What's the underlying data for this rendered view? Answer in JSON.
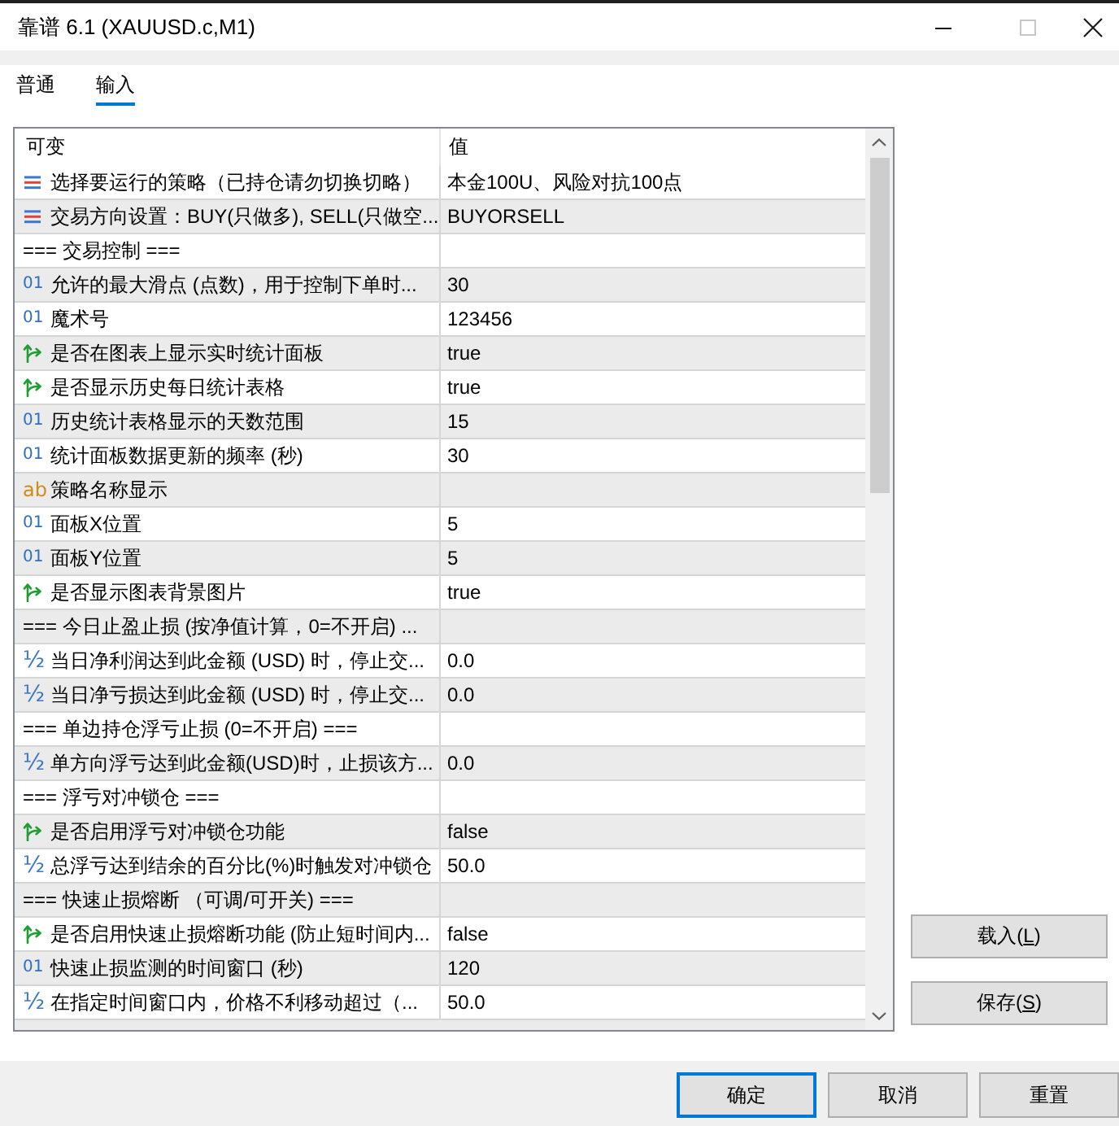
{
  "window": {
    "title": "靠谱 6.1 (XAUUSD.c,M1)",
    "controls": [
      {
        "kind": "minimize",
        "disabled": false
      },
      {
        "kind": "maximize",
        "disabled": true
      },
      {
        "kind": "close",
        "disabled": false
      }
    ]
  },
  "tabs": [
    {
      "label": "普通",
      "selected": false
    },
    {
      "label": "输入",
      "selected": true
    }
  ],
  "table": {
    "columns": [
      "可变",
      "值"
    ],
    "rows": [
      {
        "kind": "enum",
        "name": "选择要运行的策略（已持仓请勿切换切略）",
        "value": "本金100U、风险对抗100点"
      },
      {
        "kind": "enum",
        "name": "交易方向设置：BUY(只做多), SELL(只做空...",
        "value": "BUYORSELL"
      },
      {
        "kind": "section",
        "name": "=== 交易控制 ==="
      },
      {
        "kind": "int",
        "glyph": "01",
        "name": "允许的最大滑点 (点数)，用于控制下单时...",
        "value": "30"
      },
      {
        "kind": "int",
        "glyph": "01",
        "name": "魔术号",
        "value": "123456"
      },
      {
        "kind": "bool",
        "name": "是否在图表上显示实时统计面板",
        "value": "true"
      },
      {
        "kind": "bool",
        "name": "是否显示历史每日统计表格",
        "value": "true"
      },
      {
        "kind": "int",
        "glyph": "01",
        "name": "历史统计表格显示的天数范围",
        "value": "15"
      },
      {
        "kind": "int",
        "glyph": "01",
        "name": "统计面板数据更新的频率 (秒)",
        "value": "30"
      },
      {
        "kind": "string",
        "glyph": "ab",
        "name": "策略名称显示"
      },
      {
        "kind": "int",
        "glyph": "01",
        "name": "面板X位置",
        "value": "5"
      },
      {
        "kind": "int",
        "glyph": "01",
        "name": "面板Y位置",
        "value": "5"
      },
      {
        "kind": "bool",
        "name": "是否显示图表背景图片",
        "value": "true"
      },
      {
        "kind": "section",
        "name": "=== 今日止盈止损 (按净值计算，0=不开启) ..."
      },
      {
        "kind": "double",
        "glyph": "½",
        "name": "当日净利润达到此金额 (USD) 时，停止交...",
        "value": "0.0"
      },
      {
        "kind": "double",
        "glyph": "½",
        "name": "当日净亏损达到此金额 (USD) 时，停止交...",
        "value": "0.0"
      },
      {
        "kind": "section",
        "name": "=== 单边持仓浮亏止损 (0=不开启) ==="
      },
      {
        "kind": "double",
        "glyph": "½",
        "name": "单方向浮亏达到此金额(USD)时，止损该方...",
        "value": "0.0"
      },
      {
        "kind": "section",
        "name": "=== 浮亏对冲锁仓 ==="
      },
      {
        "kind": "bool",
        "name": "是否启用浮亏对冲锁仓功能",
        "value": "false"
      },
      {
        "kind": "double",
        "glyph": "½",
        "name": "总浮亏达到结余的百分比(%)时触发对冲锁仓",
        "value": "50.0"
      },
      {
        "kind": "section",
        "name": "=== 快速止损熔断 （可调/可开关) ==="
      },
      {
        "kind": "bool",
        "name": "是否启用快速止损熔断功能 (防止短时间内...",
        "value": "false"
      },
      {
        "kind": "int",
        "glyph": "01",
        "name": "快速止损监测的时间窗口 (秒)",
        "value": "120"
      },
      {
        "kind": "double",
        "glyph": "½",
        "name": "在指定时间窗口内，价格不利移动超过（...",
        "value": "50.0"
      }
    ]
  },
  "side_buttons": [
    "载入(L)",
    "保存(S)"
  ],
  "buttons": [
    {
      "label": "确定",
      "default": true
    },
    {
      "label": "取消",
      "default": false
    },
    {
      "label": "重置",
      "default": false
    }
  ]
}
